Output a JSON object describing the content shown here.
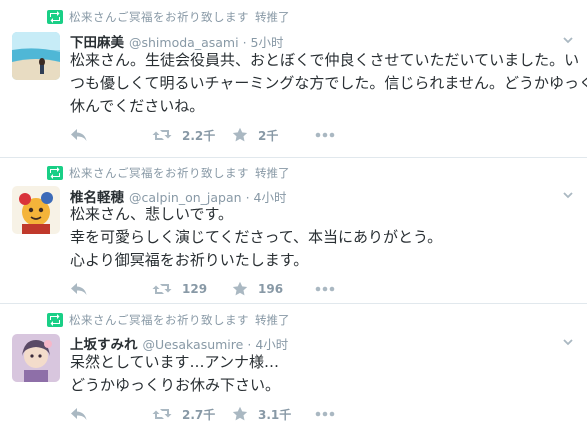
{
  "tweets": [
    {
      "retweet_label": "松来さんご冥福をお祈り致します",
      "retweeted_by": "转推了",
      "display_name": "下田麻美",
      "username": "@shimoda_asami",
      "separator": "·",
      "time": "5小时",
      "lines": [
        "松来さん。生徒会役員共、おとぼくで仲良くさせていただいていました。い",
        "つも優しくて明るいチャーミングな方でした。信じられません。どうかゆっくり",
        "休んでくださいね。"
      ],
      "retweets": "2.2千",
      "favorites": "2千",
      "icons": {
        "avatar": "beach-photo-avatar"
      }
    },
    {
      "retweet_label": "松来さんご冥福をお祈り致します",
      "retweeted_by": "转推了",
      "display_name": "椎名軽穂",
      "username": "@calpin_on_japan",
      "separator": "·",
      "time": "4小时",
      "lines": [
        "松来さん、悲しいです。",
        "幸を可愛らしく演じてくださって、本当にありがとう。",
        "心より御冥福をお祈りいたします。"
      ],
      "retweets": "129",
      "favorites": "196",
      "icons": {
        "avatar": "character-illustration-avatar"
      }
    },
    {
      "retweet_label": "松来さんご冥福をお祈り致します",
      "retweeted_by": "转推了",
      "display_name": "上坂すみれ",
      "username": "@Uesakasumire",
      "separator": "·",
      "time": "4小时",
      "lines": [
        "呆然としています…アンナ様…",
        "どうかゆっくりお休み下さい。"
      ],
      "retweets": "2.7千",
      "favorites": "3.1千",
      "icons": {
        "avatar": "portrait-photo-avatar"
      }
    }
  ],
  "colors": {
    "retweet_green": "#19cf86",
    "muted_gray": "#8899a6",
    "icon_gray": "#aab8c2",
    "text": "#292f33",
    "divider": "#e1e8ed"
  }
}
